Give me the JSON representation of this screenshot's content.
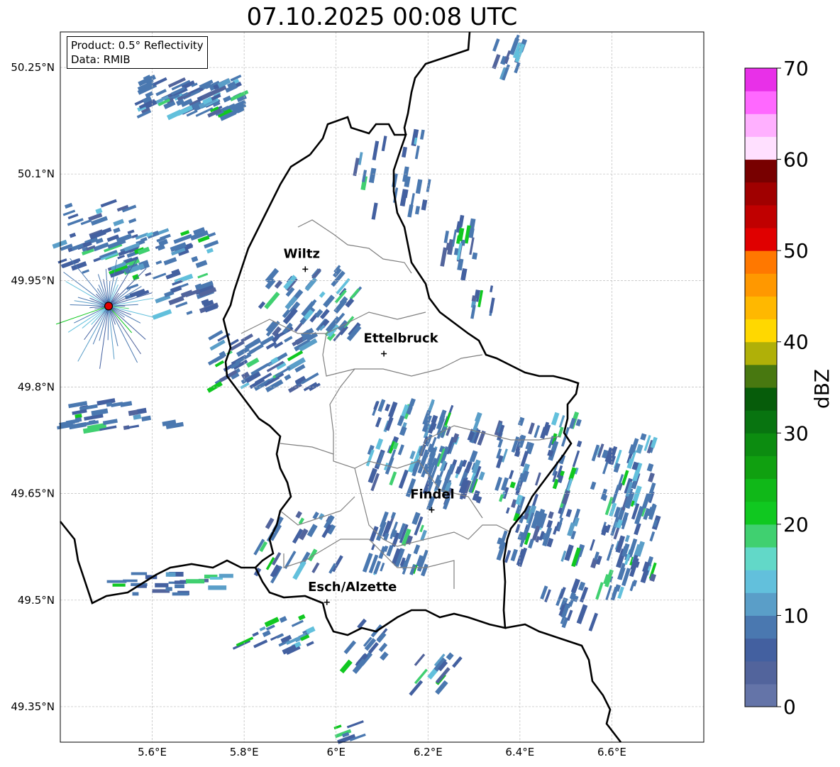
{
  "title": "07.10.2025 00:08 UTC",
  "legend": {
    "product": "Product: 0.5° Reflectivity",
    "data": "Data: RMIB"
  },
  "map": {
    "lon_range": [
      5.4,
      6.8
    ],
    "lat_range": [
      49.3,
      50.3
    ],
    "lon_ticks": [
      {
        "value": 5.6,
        "label": "5.6°E"
      },
      {
        "value": 5.8,
        "label": "5.8°E"
      },
      {
        "value": 6.0,
        "label": "6°E"
      },
      {
        "value": 6.2,
        "label": "6.2°E"
      },
      {
        "value": 6.4,
        "label": "6.4°E"
      },
      {
        "value": 6.6,
        "label": "6.6°E"
      }
    ],
    "lat_ticks": [
      {
        "value": 50.25,
        "label": "50.25°N"
      },
      {
        "value": 50.1,
        "label": "50.1°N"
      },
      {
        "value": 49.95,
        "label": "49.95°N"
      },
      {
        "value": 49.8,
        "label": "49.8°N"
      },
      {
        "value": 49.65,
        "label": "49.65°N"
      },
      {
        "value": 49.5,
        "label": "49.5°N"
      },
      {
        "value": 49.35,
        "label": "49.35°N"
      }
    ],
    "cities": [
      {
        "name": "Wiltz",
        "lon": 5.933,
        "lat": 49.966
      },
      {
        "name": "Ettelbruck",
        "lon": 6.104,
        "lat": 49.847
      },
      {
        "name": "Findel",
        "lon": 6.208,
        "lat": 49.627
      },
      {
        "name": "Esch/Alzette",
        "lon": 5.98,
        "lat": 49.497
      }
    ],
    "radar_site": {
      "lon": 5.505,
      "lat": 49.914,
      "color": "#e00000"
    }
  },
  "colorbar": {
    "label": "dBZ",
    "min": 0,
    "max": 70,
    "step": 2.5,
    "ticks": [
      "0",
      "10",
      "20",
      "30",
      "40",
      "50",
      "60",
      "70"
    ],
    "colors": [
      "#6474a8",
      "#52649c",
      "#4360a0",
      "#4a78b0",
      "#5a9ec8",
      "#62c0dc",
      "#62d8c8",
      "#40d070",
      "#10c820",
      "#10b818",
      "#10a010",
      "#0c8c10",
      "#087410",
      "#065c0a",
      "#487810",
      "#b0b008",
      "#ffd800",
      "#ffb800",
      "#ff9800",
      "#ff7800",
      "#e00000",
      "#c00000",
      "#a00000",
      "#780000",
      "#ffe0ff",
      "#ffb0ff",
      "#ff68ff",
      "#e830e8"
    ]
  }
}
